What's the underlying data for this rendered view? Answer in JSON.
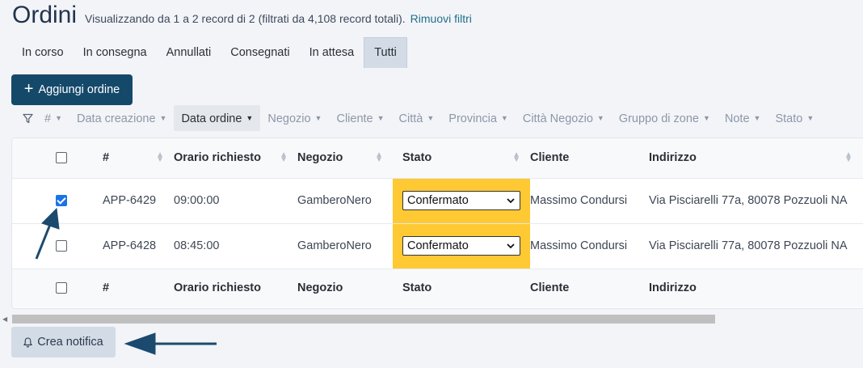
{
  "header": {
    "title": "Ordini",
    "subtitle": "Visualizzando da 1 a 2 record di 2 (filtrati da 4,108 record totali).",
    "reset_link": "Rimuovi filtri"
  },
  "tabs": [
    {
      "label": "In corso"
    },
    {
      "label": "In consegna"
    },
    {
      "label": "Annullati"
    },
    {
      "label": "Consegnati"
    },
    {
      "label": "In attesa"
    },
    {
      "label": "Tutti",
      "active": true
    }
  ],
  "add_button": {
    "label": "Aggiungi ordine"
  },
  "filters": [
    {
      "label": "#"
    },
    {
      "label": "Data creazione"
    },
    {
      "label": "Data ordine",
      "active": true
    },
    {
      "label": "Negozio"
    },
    {
      "label": "Cliente"
    },
    {
      "label": "Città"
    },
    {
      "label": "Provincia"
    },
    {
      "label": "Città Negozio"
    },
    {
      "label": "Gruppo di zone"
    },
    {
      "label": "Note"
    },
    {
      "label": "Stato"
    }
  ],
  "table": {
    "columns": [
      "#",
      "Orario richiesto",
      "Negozio",
      "Stato",
      "Cliente",
      "Indirizzo"
    ],
    "rows": [
      {
        "checked": true,
        "id": "APP-6429",
        "time": "09:00:00",
        "shop": "GamberoNero",
        "status": "Confermato",
        "client": "Massimo Condursi",
        "address": "Via Pisciarelli 77a, 80078 Pozzuoli NA"
      },
      {
        "checked": false,
        "id": "APP-6428",
        "time": "08:45:00",
        "shop": "GamberoNero",
        "status": "Confermato",
        "client": "Massimo Condursi",
        "address": "Via Pisciarelli 77a, 80078 Pozzuoli NA"
      }
    ],
    "status_highlight_color": "#ffc933"
  },
  "notify_button": {
    "label": "Crea notifica"
  },
  "colors": {
    "primary": "#15496a",
    "secondary_button": "#d3dbe6",
    "annotation_arrow": "#1c4a6e"
  }
}
